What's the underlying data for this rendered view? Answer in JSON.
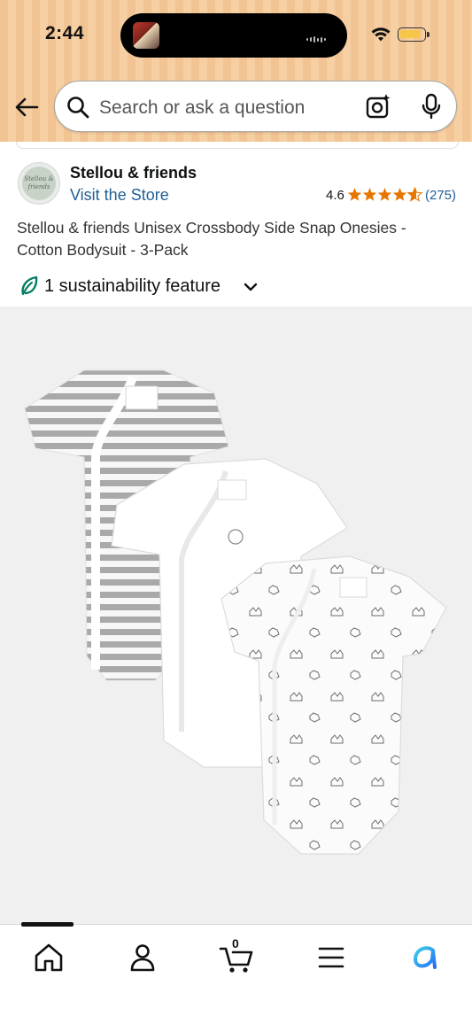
{
  "status_bar": {
    "time": "2:44",
    "battery_color": "#f7c548"
  },
  "header": {
    "background_color": "#f2c494",
    "back_icon": "arrow-left-icon",
    "search": {
      "placeholder": "Search or ask a question",
      "icons": [
        "search-icon",
        "camera-lens-icon",
        "microphone-icon"
      ]
    }
  },
  "brand": {
    "logo_text": "Stellou & friends",
    "name": "Stellou & friends",
    "visit_store": "Visit the Store"
  },
  "rating": {
    "value": "4.6",
    "stars_out_of_5": 4.6,
    "count": "(275)",
    "star_color": "#e77600"
  },
  "product": {
    "title": "Stellou & friends Unisex Crossbody Side Snap Onesies - Cotton Bodysuit - 3-Pack",
    "image_alt": "Three baby bodysuits: grey striped, plain white, and white with animal print"
  },
  "sustainability": {
    "label": "1 sustainability feature",
    "icon": "leaf-icon",
    "leaf_color": "#067d62"
  },
  "bottom_nav": {
    "items": [
      {
        "name": "home",
        "icon": "home-icon",
        "active": true
      },
      {
        "name": "account",
        "icon": "person-icon"
      },
      {
        "name": "cart",
        "icon": "cart-icon",
        "count": "0"
      },
      {
        "name": "menu",
        "icon": "hamburger-menu-icon"
      },
      {
        "name": "rufus",
        "icon": "ai-assistant-icon"
      }
    ]
  }
}
